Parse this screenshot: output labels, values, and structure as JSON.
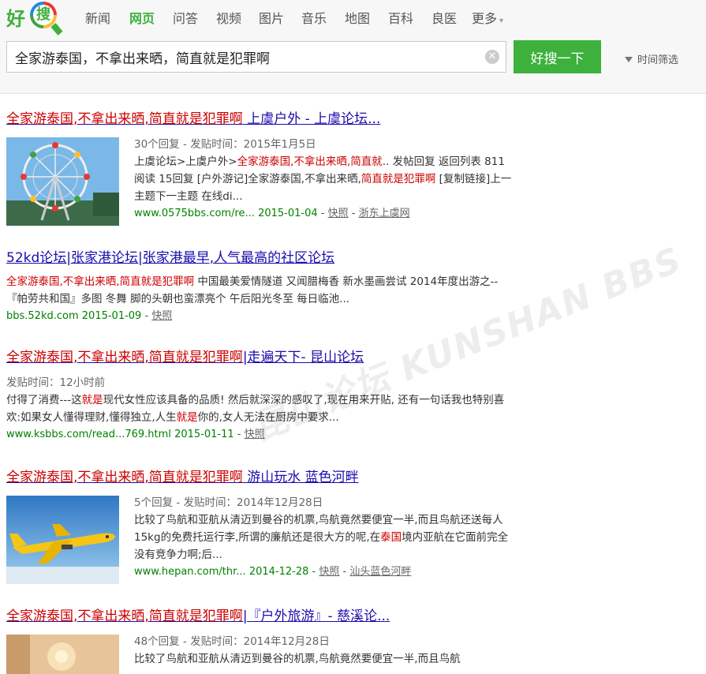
{
  "logo": {
    "hao": "好",
    "sou": "搜"
  },
  "nav": {
    "items": [
      "新闻",
      "网页",
      "问答",
      "视频",
      "图片",
      "音乐",
      "地图",
      "百科",
      "良医"
    ],
    "more": "更多"
  },
  "search": {
    "value": "全家游泰国，不拿出来晒，简直就是犯罪啊",
    "button_label": "好搜一下",
    "filter_label": "时间筛选"
  },
  "results": [
    {
      "title_hl": "全家游泰国,不拿出来晒,简直就是犯罪啊",
      "title_rest": " 上虞户外 - 上虞论坛...",
      "meta": "30个回复 - 发贴时间：2015年1月5日",
      "text_1": "上虞论坛>上虞户外>",
      "text_hl_1": "全家游泰国,不拿出来晒,简直就",
      "text_2": ".. 发帖回复 返回列表 811阅读 15回复 [户外游记]全家游泰国,不拿出来晒,",
      "text_hl_2": "简直就是犯罪啊",
      "text_3": " [复制链接]上一主题下一主题 在线di...",
      "url": "www.0575bbs.com/re...",
      "date": "2015-01-04",
      "cache": "快照",
      "site": "浙东上虞网"
    },
    {
      "title": "52kd论坛|张家港论坛|张家港最早,人气最高的社区论坛",
      "text_hl_1": "全家游泰国,不拿出来晒,简直就是犯罪啊",
      "text_1": " 中国最美爱情隧道 又闻腊梅香 新水墨画尝试 2014年度出游之--『帕劳共和国』多图 冬舞 脚的头朝也蛮漂亮个 午后阳光冬至 每日临池...",
      "url": "bbs.52kd.com",
      "date": "2015-01-09",
      "cache": "快照"
    },
    {
      "title_hl": "全家游泰国,不拿出来晒,简直就是犯罪啊",
      "title_rest": "|走遍天下- 昆山论坛",
      "meta": "发贴时间：12小时前",
      "text_1": "付得了消费---这",
      "text_hl_1": "就是",
      "text_2": "现代女性应该具备的品质! 然后就深深的感叹了,现在用来开贴, 还有一句话我也特别喜欢:如果女人懂得理财,懂得独立,人生",
      "text_hl_2": "就是",
      "text_3": "你的,女人无法在厨房中要求...",
      "url": "www.ksbbs.com/read...769.html",
      "date": "2015-01-11",
      "cache": "快照"
    },
    {
      "title_hl": "全家游泰国,不拿出来晒,简直就是犯罪啊",
      "title_rest": " 游山玩水 蓝色河畔",
      "meta": "5个回复 - 发贴时间：2014年12月28日",
      "text_1": "比较了鸟航和亚航从清迈到曼谷的机票,鸟航竟然要便宜一半,而且鸟航还送每人15kg的免费托运行李,所谓的廉航还是很大方的呢,在",
      "text_hl_1": "泰国",
      "text_2": "境内亚航在它面前完全没有竞争力啊;后...",
      "url": "www.hepan.com/thr...",
      "date": "2014-12-28",
      "cache": "快照",
      "site": "汕头蓝色河畔"
    },
    {
      "title_hl": "全家游泰国,不拿出来晒,简直就是犯罪啊",
      "title_rest": "|『户外旅游』- 慈溪论...",
      "meta": "48个回复 - 发贴时间：2014年12月28日",
      "text_1": "比较了鸟航和亚航从清迈到曼谷的机票,鸟航竟然要便宜一半,而且鸟航"
    }
  ],
  "watermark": "昆山论坛 KUNSHAN BBS"
}
